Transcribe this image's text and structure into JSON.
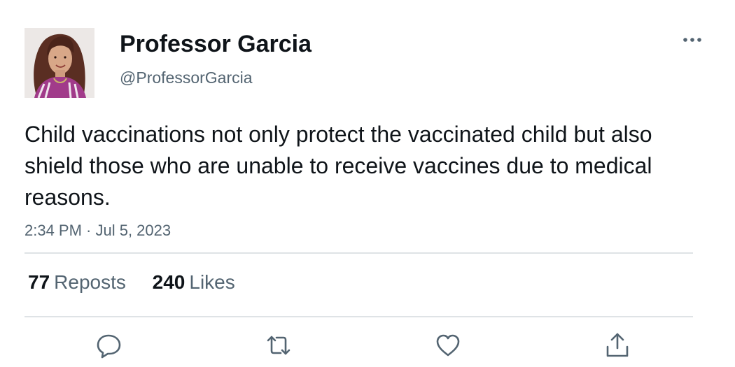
{
  "author": {
    "display_name": "Professor Garcia",
    "handle": "@ProfessorGarcia",
    "avatar_icon": "profile-photo"
  },
  "tweet": {
    "text": "Child vaccinations not only protect the vaccinated child but also shield those who are unable to receive vaccines due to medical reasons.",
    "timestamp": "2:34 PM · Jul 5, 2023"
  },
  "stats": {
    "reposts_count": "77",
    "reposts_label": "Reposts",
    "likes_count": "240",
    "likes_label": "Likes"
  },
  "actions": {
    "reply_icon": "reply-icon",
    "repost_icon": "repost-icon",
    "like_icon": "like-icon",
    "share_icon": "share-icon",
    "more_icon": "more-icon"
  },
  "colors": {
    "text_primary": "#0f1419",
    "text_secondary": "#536471",
    "divider": "#dfe3e6",
    "icon": "#536471"
  }
}
